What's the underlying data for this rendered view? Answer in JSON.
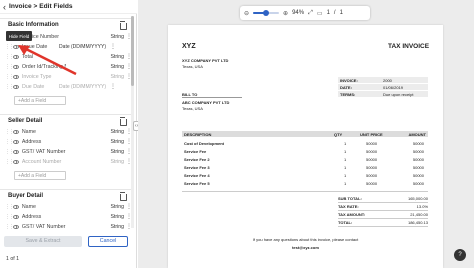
{
  "header": {
    "back_icon": "‹",
    "title": "Invoice > Edit Fields"
  },
  "tooltip": "Hide Field",
  "sections": [
    {
      "name": "Basic Information",
      "fields": [
        {
          "label": "Invoice Number",
          "value": "",
          "type": "String",
          "hidden": false
        },
        {
          "label": "Issue Date",
          "value": "Date (DD/MM/YYYY)",
          "type": "",
          "hidden": false
        },
        {
          "label": "Total",
          "value": "",
          "type": "String",
          "hidden": false
        },
        {
          "label": "Order Id/Tracking No",
          "value": "",
          "type": "String",
          "hidden": false
        },
        {
          "label": "Invoice Type",
          "value": "",
          "type": "String",
          "hidden": true
        },
        {
          "label": "Due Date",
          "value": "Date (DD/MM/YYYY)",
          "type": "",
          "hidden": true
        }
      ],
      "add_field": "+Add a Field"
    },
    {
      "name": "Seller Detail",
      "fields": [
        {
          "label": "Name",
          "value": "",
          "type": "String",
          "hidden": false
        },
        {
          "label": "Address",
          "value": "",
          "type": "String",
          "hidden": false
        },
        {
          "label": "GST/ VAT Number",
          "value": "",
          "type": "String",
          "hidden": false
        },
        {
          "label": "Account Number",
          "value": "",
          "type": "String",
          "hidden": true
        }
      ],
      "add_field": "+Add a Field"
    },
    {
      "name": "Buyer Detail",
      "fields": [
        {
          "label": "Name",
          "value": "",
          "type": "String",
          "hidden": false
        },
        {
          "label": "Address",
          "value": "",
          "type": "String",
          "hidden": false
        },
        {
          "label": "GST/ VAT Number",
          "value": "",
          "type": "String",
          "hidden": false
        }
      ]
    }
  ],
  "footer": {
    "save_label": "Save & Extract",
    "cancel_label": "Cancel",
    "pager": "1 of 1"
  },
  "viewer": {
    "zoom": "94%",
    "zoom_fraction": 0.5,
    "page_current": "1",
    "page_sep": "/",
    "page_total": "1"
  },
  "invoice": {
    "company": "XYZ",
    "doc_title": "TAX INVOICE",
    "seller_name": "XYZ COMPANY PVT LTD",
    "seller_city": "Texas, USA",
    "meta": [
      {
        "k": "INVOICE:",
        "v": "2000"
      },
      {
        "k": "DATE:",
        "v": "01/06/2019"
      },
      {
        "k": "TERMS:",
        "v": "Due upon receipt"
      }
    ],
    "bill_to_label": "BILL TO",
    "buyer_name": "ABC COMPANY PVT LTD",
    "buyer_city": "Texas, USA",
    "columns": [
      "DESCRIPTION",
      "QTY",
      "UNIT PRICE",
      "AMOUNT"
    ],
    "items": [
      {
        "d": "Cost of Development",
        "q": "1",
        "u": "50000",
        "a": "50000"
      },
      {
        "d": "Service Fee",
        "q": "1",
        "u": "50000",
        "a": "50000"
      },
      {
        "d": "Service Fee 2",
        "q": "1",
        "u": "50000",
        "a": "50000"
      },
      {
        "d": "Service Fee 3",
        "q": "1",
        "u": "50000",
        "a": "50000"
      },
      {
        "d": "Service Fee 4",
        "q": "1",
        "u": "50000",
        "a": "50000"
      },
      {
        "d": "Service Fee 5",
        "q": "1",
        "u": "50000",
        "a": "50000"
      }
    ],
    "totals": [
      {
        "k": "SUB TOTAL:",
        "v": "165,000.00"
      },
      {
        "k": "TAX RATE:",
        "v": "13.0%"
      },
      {
        "k": "TAX AMOUNT:",
        "v": "21,450.00"
      },
      {
        "k": "TOTAL:",
        "v": "186,450.13"
      }
    ],
    "note": "If you have any questions about this invoice, please contact",
    "email": "test@xyz.com"
  },
  "colors": {
    "accent": "#2f63c4",
    "arrow": "#e0352b"
  },
  "help_label": "?"
}
